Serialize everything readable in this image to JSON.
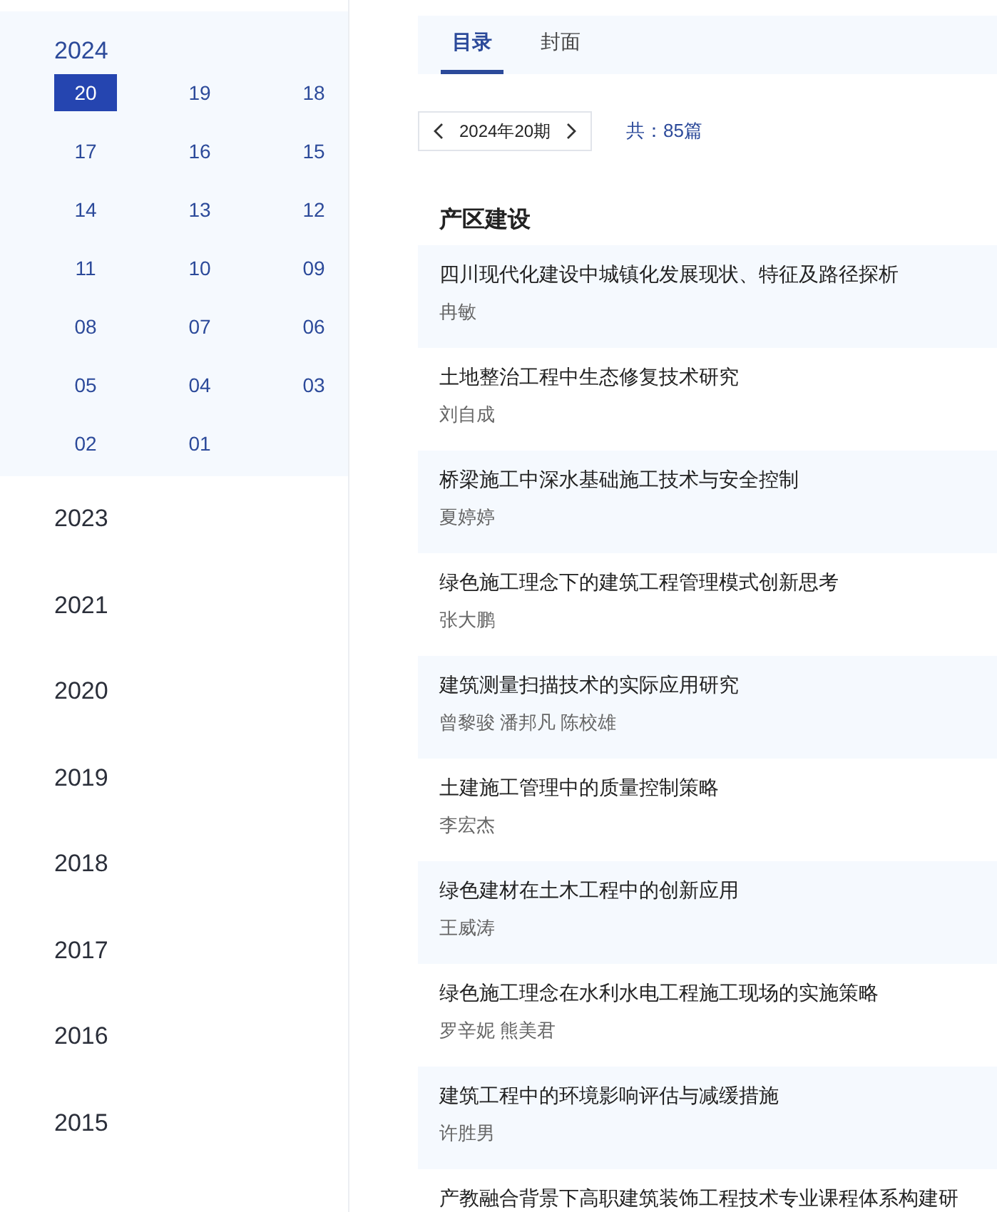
{
  "sidebar": {
    "years": [
      {
        "year": "2024",
        "expanded": true,
        "issues": [
          {
            "label": "20",
            "selected": true
          },
          {
            "label": "19",
            "selected": false
          },
          {
            "label": "18",
            "selected": false
          },
          {
            "label": "17",
            "selected": false
          },
          {
            "label": "16",
            "selected": false
          },
          {
            "label": "15",
            "selected": false
          },
          {
            "label": "14",
            "selected": false
          },
          {
            "label": "13",
            "selected": false
          },
          {
            "label": "12",
            "selected": false
          },
          {
            "label": "11",
            "selected": false
          },
          {
            "label": "10",
            "selected": false
          },
          {
            "label": "09",
            "selected": false
          },
          {
            "label": "08",
            "selected": false
          },
          {
            "label": "07",
            "selected": false
          },
          {
            "label": "06",
            "selected": false
          },
          {
            "label": "05",
            "selected": false
          },
          {
            "label": "04",
            "selected": false
          },
          {
            "label": "03",
            "selected": false
          },
          {
            "label": "02",
            "selected": false
          },
          {
            "label": "01",
            "selected": false
          }
        ]
      },
      {
        "year": "2023",
        "expanded": false
      },
      {
        "year": "2021",
        "expanded": false
      },
      {
        "year": "2020",
        "expanded": false
      },
      {
        "year": "2019",
        "expanded": false
      },
      {
        "year": "2018",
        "expanded": false
      },
      {
        "year": "2017",
        "expanded": false
      },
      {
        "year": "2016",
        "expanded": false
      },
      {
        "year": "2015",
        "expanded": false
      }
    ]
  },
  "tabs": [
    {
      "label": "目录",
      "selected": true
    },
    {
      "label": "封面",
      "selected": false
    }
  ],
  "pager": {
    "issue": "2024年20期",
    "total": "共：85篇"
  },
  "section": {
    "title": "产区建设",
    "articles": [
      {
        "title": "四川现代化建设中城镇化发展现状、特征及路径探析",
        "authors": "冉敏"
      },
      {
        "title": "土地整治工程中生态修复技术研究",
        "authors": "刘自成"
      },
      {
        "title": "桥梁施工中深水基础施工技术与安全控制",
        "authors": "夏婷婷"
      },
      {
        "title": "绿色施工理念下的建筑工程管理模式创新思考",
        "authors": "张大鹏"
      },
      {
        "title": "建筑测量扫描技术的实际应用研究",
        "authors": "曾黎骏 潘邦凡 陈校雄"
      },
      {
        "title": "土建施工管理中的质量控制策略",
        "authors": "李宏杰"
      },
      {
        "title": "绿色建材在土木工程中的创新应用",
        "authors": "王威涛"
      },
      {
        "title": "绿色施工理念在水利水电工程施工现场的实施策略",
        "authors": "罗辛妮 熊美君"
      },
      {
        "title": "建筑工程中的环境影响评估与减缓措施",
        "authors": "许胜男"
      },
      {
        "title": "产教融合背景下高职建筑装饰工程技术专业课程体系构建研"
      }
    ]
  }
}
